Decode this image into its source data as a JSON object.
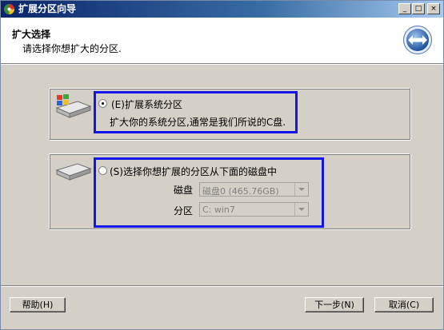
{
  "window": {
    "title": "扩展分区向导",
    "controls": {
      "minimize": "_",
      "maximize": "□",
      "close": "×"
    }
  },
  "header": {
    "title": "扩大选择",
    "subtitle": "请选择你想扩大的分区."
  },
  "option1": {
    "label": "(E)扩展系统分区",
    "description": "扩大你的系统分区,通常是我们所说的C盘.",
    "selected": true,
    "icon": "system-drive-icon"
  },
  "option2": {
    "label": "(S)选择你想扩展的分区从下面的磁盘中",
    "selected": false,
    "icon": "hard-drive-icon",
    "disk_label": "磁盘",
    "disk_value": "磁盘0 (465.76GB)",
    "partition_label": "分区",
    "partition_value": "C: win7"
  },
  "buttons": {
    "help": "帮助(H)",
    "next": "下一步(N)",
    "cancel": "取消(C)"
  },
  "colors": {
    "highlight_border": "#1414e6",
    "titlebar": "#0a246a"
  }
}
